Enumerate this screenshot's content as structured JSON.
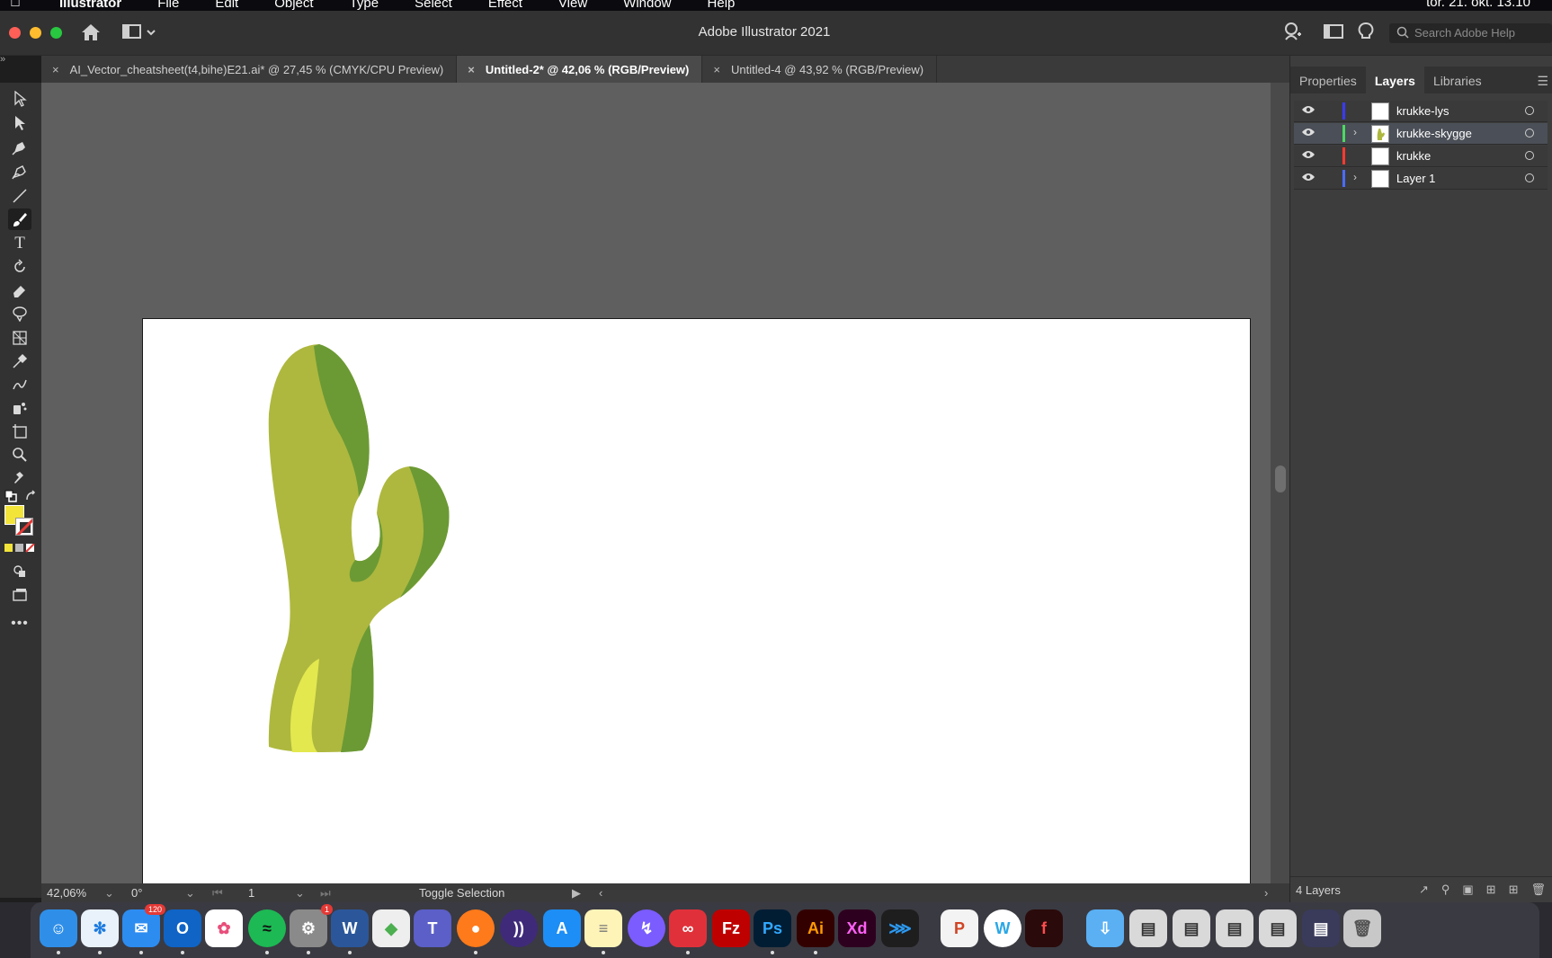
{
  "menubar": {
    "app_name": "Illustrator",
    "items": [
      "File",
      "Edit",
      "Object",
      "Type",
      "Select",
      "Effect",
      "View",
      "Window",
      "Help"
    ],
    "clock": "tor. 21. okt. 13.10"
  },
  "window": {
    "title": "Adobe Illustrator 2021",
    "search_placeholder": "Search Adobe Help"
  },
  "tabs": [
    {
      "label": "AI_Vector_cheatsheet(t4,bihe)E21.ai* @ 27,45 % (CMYK/CPU Preview)",
      "active": false
    },
    {
      "label": "Untitled-2* @ 42,06 % (RGB/Preview)",
      "active": true
    },
    {
      "label": "Untitled-4 @ 43,92 % (RGB/Preview)",
      "active": false
    }
  ],
  "panel": {
    "tabs": [
      "Properties",
      "Layers",
      "Libraries"
    ],
    "active_tab": "Layers",
    "layers": [
      {
        "name": "krukke-lys",
        "color": "#3a3aff",
        "expandable": false,
        "selected": false
      },
      {
        "name": "krukke-skygge",
        "color": "#4cd964",
        "expandable": true,
        "selected": true
      },
      {
        "name": "krukke",
        "color": "#ff3b30",
        "expandable": false,
        "selected": false
      },
      {
        "name": "Layer 1",
        "color": "#4a6cff",
        "expandable": true,
        "selected": false
      }
    ],
    "layer_count": "4 Layers"
  },
  "status": {
    "zoom": "42,06%",
    "rotation": "0°",
    "artboard_number": "1",
    "mode": "Toggle Selection"
  },
  "colors": {
    "fill": "#f3e43a",
    "cactus_main": "#aeb83e",
    "cactus_shadow": "#6b9a35",
    "cactus_light": "#e3e84f"
  },
  "dock": {
    "mail_badge": "120",
    "settings_badge": "1"
  }
}
